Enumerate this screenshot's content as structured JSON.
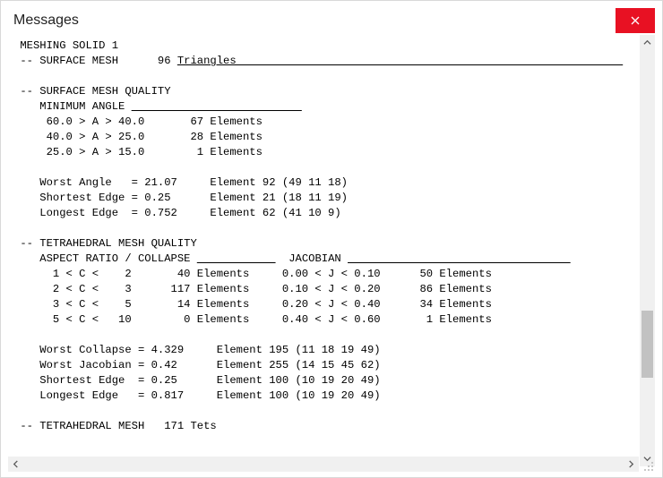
{
  "window": {
    "title": "Messages"
  },
  "log": {
    "lines": [
      {
        "t": " MESHING SOLID 1"
      },
      {
        "t": " -- SURFACE MESH      96 ",
        "heading_from": 25,
        "trail_len": 68,
        "trail_text": "Triangles"
      },
      {
        "t": ""
      },
      {
        "t": " -- SURFACE MESH QUALITY"
      },
      {
        "t": "    MINIMUM ANGLE ",
        "trail_len": 26
      },
      {
        "t": "     60.0 > A > 40.0       67 Elements"
      },
      {
        "t": "     40.0 > A > 25.0       28 Elements"
      },
      {
        "t": "     25.0 > A > 15.0        1 Elements"
      },
      {
        "t": ""
      },
      {
        "t": "    Worst Angle   = 21.07     Element 92 (49 11 18)"
      },
      {
        "t": "    Shortest Edge = 0.25      Element 21 (18 11 19)"
      },
      {
        "t": "    Longest Edge  = 0.752     Element 62 (41 10 9)"
      },
      {
        "t": ""
      },
      {
        "t": " -- TETRAHEDRAL MESH QUALITY"
      },
      {
        "t": "    ASPECT RATIO / COLLAPSE ",
        "trail_len": 12,
        "mid_text": "  JACOBIAN ",
        "trail2_len": 34
      },
      {
        "t": "      1 < C <    2       40 Elements     0.00 < J < 0.10      50 Elements"
      },
      {
        "t": "      2 < C <    3      117 Elements     0.10 < J < 0.20      86 Elements"
      },
      {
        "t": "      3 < C <    5       14 Elements     0.20 < J < 0.40      34 Elements"
      },
      {
        "t": "      5 < C <   10        0 Elements     0.40 < J < 0.60       1 Elements"
      },
      {
        "t": ""
      },
      {
        "t": "    Worst Collapse = 4.329     Element 195 (11 18 19 49)"
      },
      {
        "t": "    Worst Jacobian = 0.42      Element 255 (14 15 45 62)"
      },
      {
        "t": "    Shortest Edge  = 0.25      Element 100 (10 19 20 49)"
      },
      {
        "t": "    Longest Edge   = 0.817     Element 100 (10 19 20 49)"
      },
      {
        "t": ""
      },
      {
        "t": " -- TETRAHEDRAL MESH   171 Tets"
      }
    ]
  }
}
